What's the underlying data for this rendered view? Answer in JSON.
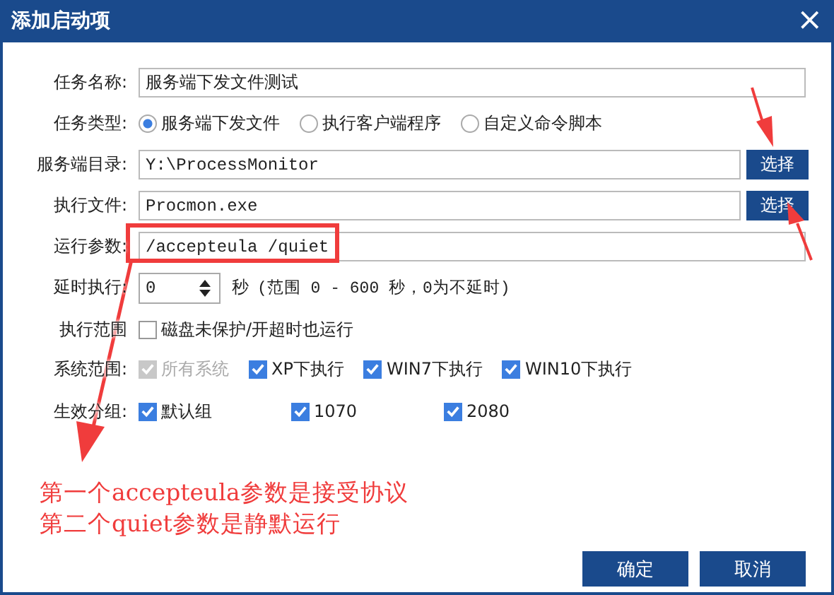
{
  "window": {
    "title": "添加启动项",
    "close": "×"
  },
  "task_name": {
    "label": "任务名称:",
    "value": "服务端下发文件测试"
  },
  "task_type": {
    "label": "任务类型:",
    "options": [
      {
        "label": "服务端下发文件",
        "selected": true
      },
      {
        "label": "执行客户端程序",
        "selected": false
      },
      {
        "label": "自定义命令脚本",
        "selected": false
      }
    ]
  },
  "server_dir": {
    "label": "服务端目录:",
    "value": "Y:\\ProcessMonitor",
    "button": "选择"
  },
  "exec_file": {
    "label": "执行文件:",
    "value": "Procmon.exe",
    "button": "选择"
  },
  "run_params": {
    "label": "运行参数:",
    "value": "/accepteula /quiet",
    "highlighted": true
  },
  "delay": {
    "label": "延时执行:",
    "value": "0",
    "unit": "秒",
    "hint": "(范围 0 - 600 秒，0为不延时)"
  },
  "exec_scope": {
    "label": "执行范围",
    "options": [
      {
        "label": "磁盘未保护/开超时也运行",
        "checked": false,
        "disabled": false
      }
    ]
  },
  "system_scope": {
    "label": "系统范围:",
    "options": [
      {
        "label": "所有系统",
        "checked": true,
        "disabled": true
      },
      {
        "label": "XP下执行",
        "checked": true,
        "disabled": false
      },
      {
        "label": "WIN7下执行",
        "checked": true,
        "disabled": false
      },
      {
        "label": "WIN10下执行",
        "checked": true,
        "disabled": false
      }
    ]
  },
  "groups": {
    "label": "生效分组:",
    "options": [
      {
        "label": "默认组",
        "checked": true,
        "disabled": false
      },
      {
        "label": "1070",
        "checked": true,
        "disabled": false
      },
      {
        "label": "2080",
        "checked": true,
        "disabled": false
      }
    ]
  },
  "annotation": [
    "第一个accepteula参数是接受协议",
    "第二个quiet参数是静默运行"
  ],
  "buttons": [
    "确定",
    "取消"
  ]
}
